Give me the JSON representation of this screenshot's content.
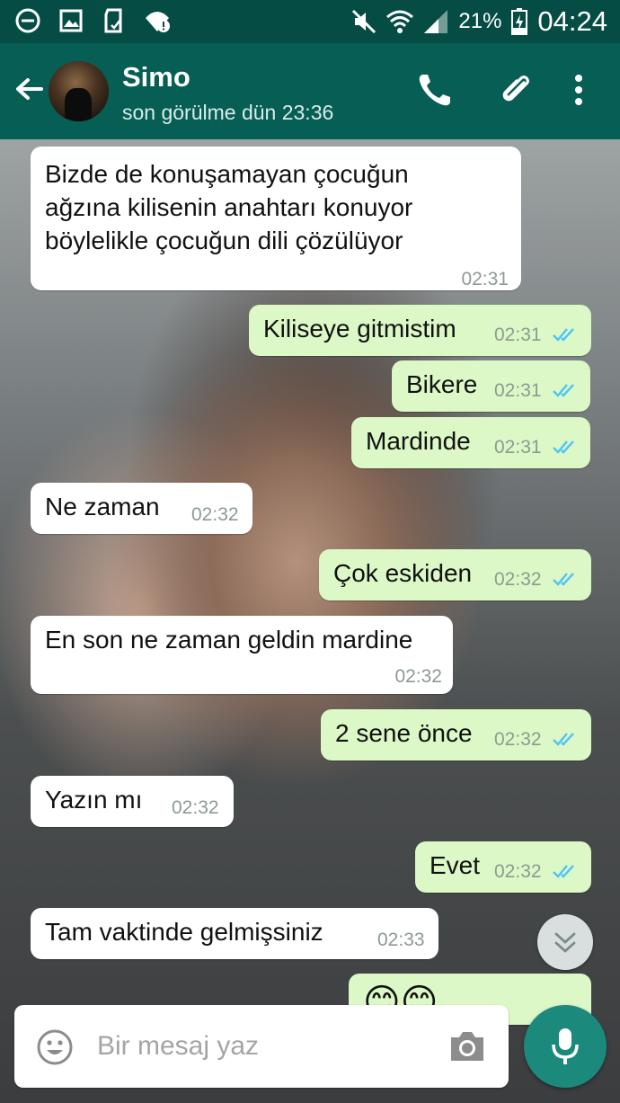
{
  "status_bar": {
    "battery_percent": "21%",
    "clock": "04:24",
    "icons_left": [
      "dnd-icon",
      "image-icon",
      "sd-card-icon",
      "wifi-alert-icon"
    ],
    "icons_right": [
      "mute-icon",
      "wifi-icon",
      "signal-icon",
      "battery-charging-icon"
    ]
  },
  "header": {
    "contact_name": "Simo",
    "last_seen": "son görülme dün 23:36",
    "actions": [
      "back-arrow-icon",
      "phone-icon",
      "attach-icon",
      "more-vert-icon"
    ],
    "colors": {
      "status_bar": "#054d44",
      "app_bar": "#075e54"
    }
  },
  "messages": [
    {
      "dir": "in",
      "lines": [
        "Bizde de konuşamayan çocuğun",
        "ağzına kilisenin anahtarı konuyor",
        "böylelikle çocuğun dili çözülüyor"
      ],
      "time": "02:31"
    },
    {
      "dir": "out",
      "text": "Kiliseye gitmistim",
      "time": "02:31",
      "read": true
    },
    {
      "dir": "out",
      "text": "Bikere",
      "time": "02:31",
      "read": true
    },
    {
      "dir": "out",
      "text": "Mardinde",
      "time": "02:31",
      "read": true
    },
    {
      "dir": "in",
      "text": "Ne zaman",
      "time": "02:32"
    },
    {
      "dir": "out",
      "text": "Çok eskiden",
      "time": "02:32",
      "read": true
    },
    {
      "dir": "in",
      "text": "En son ne zaman geldin mardine",
      "time": "02:32"
    },
    {
      "dir": "out",
      "text": "2 sene önce",
      "time": "02:32",
      "read": true
    },
    {
      "dir": "in",
      "text": "Yazın mı",
      "time": "02:32"
    },
    {
      "dir": "out",
      "text": "Evet",
      "time": "02:32",
      "read": true
    },
    {
      "dir": "in",
      "text": "Tam vaktinde gelmişsiniz",
      "time": "02:33"
    },
    {
      "dir": "out",
      "text": "😊😊",
      "time": "",
      "read": true,
      "partial": true
    }
  ],
  "composer": {
    "placeholder": "Bir mesaj yaz",
    "value": "",
    "icons": [
      "emoji-icon",
      "camera-icon",
      "mic-icon"
    ]
  },
  "colors": {
    "incoming_bubble": "#ffffff",
    "outgoing_bubble": "#dcf8c6",
    "read_ticks": "#4fc3f7",
    "mic_button": "#1b8a7d"
  }
}
